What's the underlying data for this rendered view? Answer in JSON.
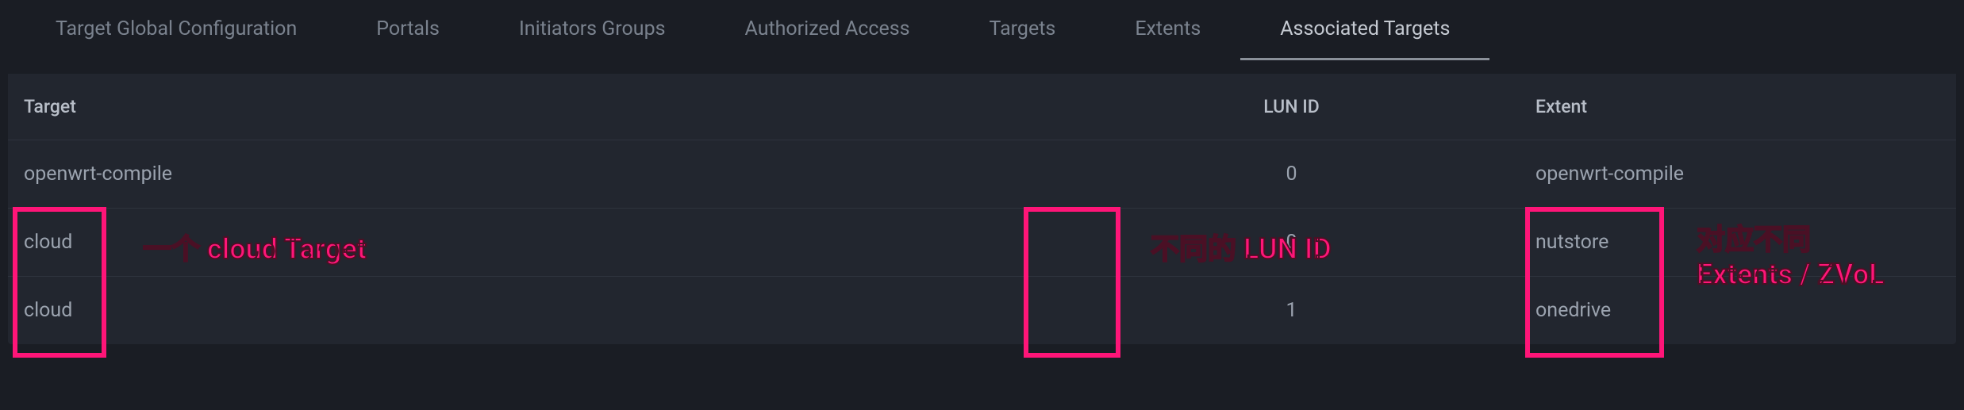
{
  "tabs": [
    {
      "label": "Target Global Configuration",
      "active": false
    },
    {
      "label": "Portals",
      "active": false
    },
    {
      "label": "Initiators Groups",
      "active": false
    },
    {
      "label": "Authorized Access",
      "active": false
    },
    {
      "label": "Targets",
      "active": false
    },
    {
      "label": "Extents",
      "active": false
    },
    {
      "label": "Associated Targets",
      "active": true
    }
  ],
  "table": {
    "headers": {
      "target": "Target",
      "lunid": "LUN ID",
      "extent": "Extent"
    },
    "rows": [
      {
        "target": "openwrt-compile",
        "lunid": "0",
        "extent": "openwrt-compile"
      },
      {
        "target": "cloud",
        "lunid": "0",
        "extent": "nutstore"
      },
      {
        "target": "cloud",
        "lunid": "1",
        "extent": "onedrive"
      }
    ]
  },
  "annotations": {
    "target_note": "一个 cloud Target",
    "lunid_note": "不同的 LUN ID",
    "extent_note_l1": "对应不同",
    "extent_note_l2": "Extents / ZVoL"
  },
  "colors": {
    "highlight": "#ff1578"
  }
}
